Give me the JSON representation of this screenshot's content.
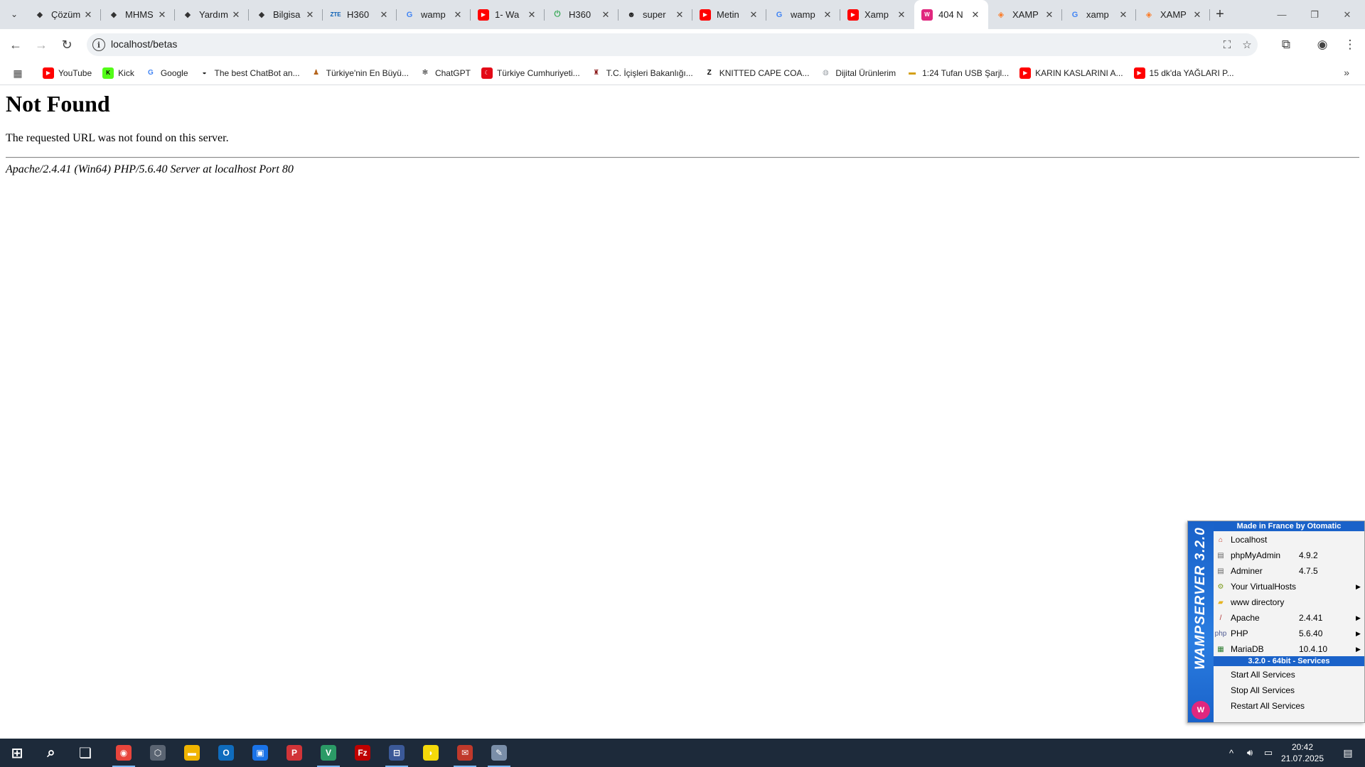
{
  "browser": {
    "tabs": [
      {
        "label": "Çözüm",
        "favicon": "diamond-icon",
        "fav_color": "#333333"
      },
      {
        "label": "MHMS",
        "favicon": "diamond-icon",
        "fav_color": "#333333"
      },
      {
        "label": "Yardım",
        "favicon": "diamond-icon",
        "fav_color": "#333333"
      },
      {
        "label": "Bilgisa",
        "favicon": "diamond-icon",
        "fav_color": "#333333"
      },
      {
        "label": "H360",
        "favicon": "zte-icon",
        "fav_color": "#0a5fb4"
      },
      {
        "label": "wamp",
        "favicon": "google-icon",
        "fav_color": "#4285f4"
      },
      {
        "label": "1- Wa",
        "favicon": "youtube-icon",
        "fav_color": "#ff0000"
      },
      {
        "label": "H360",
        "favicon": "power-icon",
        "fav_color": "#34a853"
      },
      {
        "label": "super",
        "favicon": "skull-icon",
        "fav_color": "#222222"
      },
      {
        "label": "Metin",
        "favicon": "youtube-icon",
        "fav_color": "#ff0000"
      },
      {
        "label": "wamp",
        "favicon": "google-icon",
        "fav_color": "#4285f4"
      },
      {
        "label": "Xamp",
        "favicon": "youtube-icon",
        "fav_color": "#ff0000"
      },
      {
        "label": "404 N",
        "favicon": "wamp-icon",
        "fav_color": "#e0277e",
        "active": true
      },
      {
        "label": "XAMP",
        "favicon": "xampp-icon",
        "fav_color": "#fb7a24"
      },
      {
        "label": "xamp",
        "favicon": "google-icon",
        "fav_color": "#4285f4"
      },
      {
        "label": "XAMP",
        "favicon": "xampp-icon",
        "fav_color": "#fb7a24"
      }
    ],
    "url": "localhost/betas",
    "bookmarks": [
      {
        "label": "YouTube",
        "favicon": "youtube-icon",
        "fav_color": "#ff0000"
      },
      {
        "label": "Kick",
        "favicon": "kick-icon",
        "fav_color": "#53fc18"
      },
      {
        "label": "Google",
        "favicon": "google-icon",
        "fav_color": "#4285f4"
      },
      {
        "label": "The best ChatBot an...",
        "favicon": "chatbot-icon",
        "fav_color": "#222222"
      },
      {
        "label": "Türkiye'nin En Büyü...",
        "favicon": "person-icon",
        "fav_color": "#b5651d"
      },
      {
        "label": "ChatGPT",
        "favicon": "openai-icon",
        "fav_color": "#333333"
      },
      {
        "label": "Türkiye Cumhuriyeti...",
        "favicon": "crescent-icon",
        "fav_color": "#e30a17"
      },
      {
        "label": "T.C. İçişleri Bakanlığı...",
        "favicon": "emblem-icon",
        "fav_color": "#8b1a1a"
      },
      {
        "label": "KNITTED CAPE COA...",
        "favicon": "zara-icon",
        "fav_color": "#000000"
      },
      {
        "label": "Dijital Ürünlerim",
        "favicon": "globe-icon",
        "fav_color": "#9aa0a6"
      },
      {
        "label": "1:24 Tufan USB Şarjl...",
        "favicon": "car-icon",
        "fav_color": "#d4a017"
      },
      {
        "label": "KARIN KASLARINI A...",
        "favicon": "youtube-icon",
        "fav_color": "#ff0000"
      },
      {
        "label": "15 dk'da YAĞLARI P...",
        "favicon": "youtube-icon",
        "fav_color": "#ff0000"
      }
    ]
  },
  "page": {
    "heading": "Not Found",
    "message": "The requested URL was not found on this server.",
    "address": "Apache/2.4.41 (Win64) PHP/5.6.40 Server at localhost Port 80"
  },
  "wamp_menu": {
    "side_title": "WAMPSERVER 3.2.0",
    "header": "Made in France by Otomatic",
    "items": [
      {
        "label": "Localhost",
        "version": "",
        "submenu": false,
        "icon": "home-icon"
      },
      {
        "label": "phpMyAdmin",
        "version": "4.9.2",
        "submenu": false,
        "icon": "database-icon"
      },
      {
        "label": "Adminer",
        "version": "4.7.5",
        "submenu": false,
        "icon": "database-icon"
      },
      {
        "label": "Your VirtualHosts",
        "version": "",
        "submenu": true,
        "icon": "gear-icon"
      },
      {
        "label": "www directory",
        "version": "",
        "submenu": false,
        "icon": "folder-icon"
      },
      {
        "label": "Apache",
        "version": "2.4.41",
        "submenu": true,
        "icon": "feather-icon"
      },
      {
        "label": "PHP",
        "version": "5.6.40",
        "submenu": true,
        "icon": "php-icon"
      },
      {
        "label": "MariaDB",
        "version": "10.4.10",
        "submenu": true,
        "icon": "mariadb-icon"
      }
    ],
    "services_header": "3.2.0 - 64bit - Services",
    "services": [
      {
        "label": "Start All Services"
      },
      {
        "label": "Stop All Services"
      },
      {
        "label": "Restart All Services"
      }
    ]
  },
  "taskbar": {
    "apps": [
      {
        "name": "start-icon"
      },
      {
        "name": "search-icon"
      },
      {
        "name": "task-view-icon"
      },
      {
        "name": "chrome-icon",
        "running": true
      },
      {
        "name": "app-hexagon-icon"
      },
      {
        "name": "file-explorer-icon"
      },
      {
        "name": "outlook-icon"
      },
      {
        "name": "store-icon"
      },
      {
        "name": "app-red-icon"
      },
      {
        "name": "vscode-icon",
        "running": true
      },
      {
        "name": "filezilla-icon"
      },
      {
        "name": "network-icon",
        "running": true
      },
      {
        "name": "sticky-icon"
      },
      {
        "name": "app-mail-icon",
        "running": true
      },
      {
        "name": "paint-icon",
        "running": true
      }
    ],
    "time": "20:42",
    "date": "21.07.2025"
  },
  "colors": {
    "wamp_blue": "#1a62c9",
    "taskbar": "#1d2a3a",
    "tabstrip": "#dfe3e8"
  }
}
